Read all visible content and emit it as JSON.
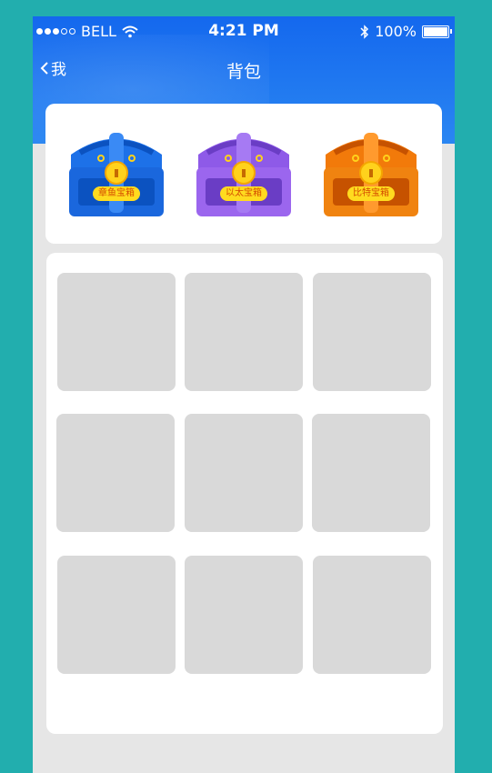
{
  "status": {
    "carrier": "BELL",
    "time": "4:21 PM",
    "battery": "100%"
  },
  "nav": {
    "back_label": "我",
    "title": "背包"
  },
  "chests": [
    {
      "label": "章鱼宝箱",
      "color": "#1d71e8"
    },
    {
      "label": "以太宝箱",
      "color": "#8e5ae8"
    },
    {
      "label": "比特宝箱",
      "color": "#f27a0a"
    }
  ],
  "grid": {
    "slots": 9
  }
}
